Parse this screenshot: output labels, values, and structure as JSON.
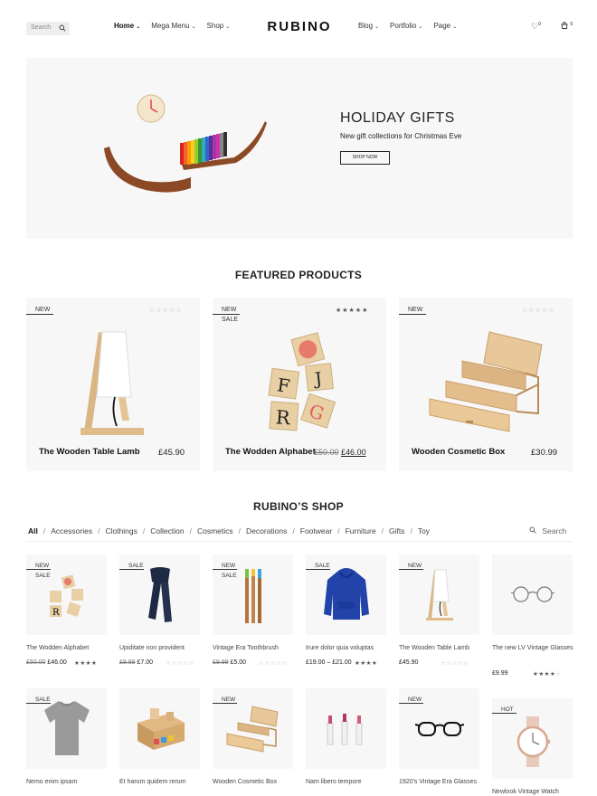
{
  "header": {
    "search_placeholder": "Search",
    "nav_left": [
      "Home",
      "Mega Menu",
      "Shop"
    ],
    "logo": "RUBINO",
    "nav_right": [
      "Blog",
      "Portfolio",
      "Page"
    ],
    "wishlist_count": "0",
    "cart_count": "0"
  },
  "hero": {
    "title": "HOLIDAY GIFTS",
    "subtitle": "New gift collections for Christmas Eve",
    "button": "SHOP NOW"
  },
  "featured": {
    "title": "FEATURED PRODUCTS",
    "products": [
      {
        "badge": "NEW",
        "name": "The Wooden Table Lamb",
        "price": "£45.90",
        "rating": 0
      },
      {
        "badge": "NEW",
        "badge2": "SALE",
        "name": "The Wodden Alphabet",
        "old_price": "£50.00",
        "price": "£46.00",
        "rating": 5
      },
      {
        "badge": "NEW",
        "name": "Wooden Cosmetic Box",
        "price": "£30.99",
        "rating": 0
      }
    ]
  },
  "shop": {
    "title": "RUBINO’S SHOP",
    "filters": [
      "All",
      "Accessories",
      "Clothings",
      "Collection",
      "Cosmetics",
      "Decorations",
      "Footwear",
      "Furniture",
      "Gifts",
      "Toy"
    ],
    "active_filter": "All",
    "search_placeholder": "Search",
    "products": [
      {
        "badge": "NEW",
        "badge2": "SALE",
        "name": "The Wodden Alphabet",
        "old_price": "£50.00",
        "price": "£46.00",
        "rating": 5
      },
      {
        "badge": "SALE",
        "name": "Upiditate non provident",
        "old_price": "£9.99",
        "price": "£7.00",
        "rating": 0
      },
      {
        "badge": "NEW",
        "badge2": "SALE",
        "name": "Vintage Era Toothbrush",
        "old_price": "£9.99",
        "price": "£5.00",
        "rating": 0
      },
      {
        "badge": "SALE",
        "name": "Irure dolor quia voluptas",
        "price": "£19.00 – £21.00",
        "rating": 5
      },
      {
        "badge": "NEW",
        "name": "The Wooden Table Lamb",
        "price": "£45.90",
        "rating": 0
      },
      {
        "badge": "",
        "name": "The new LV Vintage Glasses",
        "price": "£9.99",
        "rating": 4
      },
      {
        "badge": "SALE",
        "name": "Nemo enim ipsam",
        "price": "",
        "rating": 0
      },
      {
        "badge": "",
        "name": "Et harum quidem rerum",
        "price": "",
        "rating": 0
      },
      {
        "badge": "NEW",
        "name": "Wooden Cosmetic Box",
        "price": "",
        "rating": 0
      },
      {
        "badge": "",
        "name": "Nam libero tempore",
        "price": "",
        "rating": 0
      },
      {
        "badge": "NEW",
        "name": "1920's Vintage Era Glasses",
        "price": "",
        "rating": 0
      },
      {
        "badge": "HOT",
        "name": "Newlook Vintage Watch",
        "price": "",
        "rating": 0
      }
    ]
  },
  "icons": [
    "search-icon",
    "chevron-down-icon",
    "heart-icon",
    "cart-icon",
    "star-icon"
  ]
}
